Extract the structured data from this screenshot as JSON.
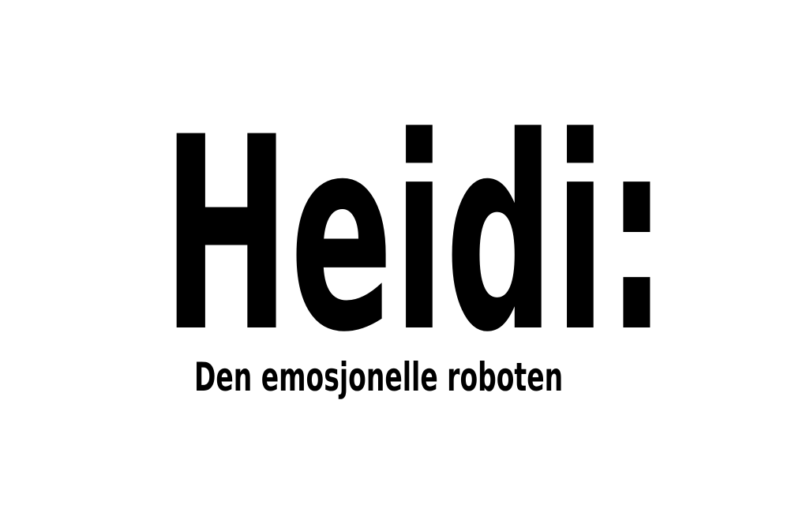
{
  "title": "Heidi:",
  "subtitle": "Den emosjonelle roboten",
  "colors": {
    "background": "#ffffff",
    "text": "#000000"
  }
}
